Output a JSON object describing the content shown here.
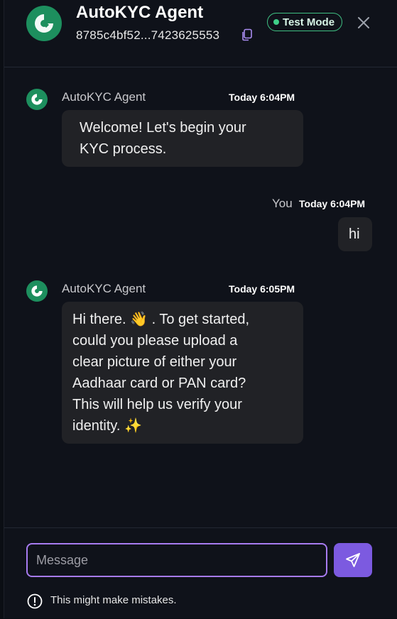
{
  "header": {
    "title": "AutoKYC Agent",
    "session_id": "8785c4bf52...7423625553",
    "badge": "Test Mode"
  },
  "messages": [
    {
      "sender": "AutoKYC Agent",
      "time": "Today 6:04PM",
      "text": "Welcome! Let's begin your\nKYC process."
    },
    {
      "sender": "You",
      "time": "Today 6:04PM",
      "text": "hi"
    },
    {
      "sender": "AutoKYC Agent",
      "time": "Today 6:05PM",
      "text": "Hi there. 👋 . To get started,\ncould you please upload a\nclear picture of either your\nAadhaar card or PAN card?\nThis will help us verify your\nidentity. ✨"
    }
  ],
  "composer": {
    "placeholder": "Message",
    "disclaimer": "This might make mistakes."
  },
  "colors": {
    "brand_green": "#1d8f5e",
    "accent_purple": "#7c5ae0",
    "input_border": "#a77bf0"
  }
}
